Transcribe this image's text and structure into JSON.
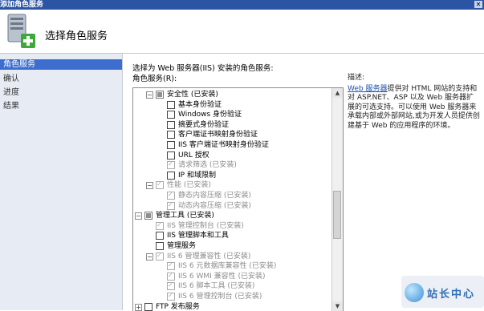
{
  "window": {
    "title": "添加角色服务",
    "close_glyph": "✕"
  },
  "header": {
    "title": "选择角色服务",
    "icon": "server-add-icon"
  },
  "nav": {
    "items": [
      {
        "label": "角色服务",
        "active": true
      },
      {
        "label": "确认",
        "active": false
      },
      {
        "label": "进度",
        "active": false
      },
      {
        "label": "结果",
        "active": false
      }
    ]
  },
  "main": {
    "prompt": "选择为 Web 服务器(IIS) 安装的角色服务:",
    "list_label": "角色服务(R):",
    "tree": [
      {
        "label": "安全性  (已安装)",
        "level": 1,
        "expander": "−",
        "state": "part",
        "disabled": false
      },
      {
        "label": "基本身份验证",
        "level": 2,
        "state": "off",
        "disabled": false
      },
      {
        "label": "Windows 身份验证",
        "level": 2,
        "state": "off",
        "disabled": false
      },
      {
        "label": "摘要式身份验证",
        "level": 2,
        "state": "off",
        "disabled": false
      },
      {
        "label": "客户端证书映射身份验证",
        "level": 2,
        "state": "off",
        "disabled": false
      },
      {
        "label": "IIS 客户端证书映射身份验证",
        "level": 2,
        "state": "off",
        "disabled": false
      },
      {
        "label": "URL 授权",
        "level": 2,
        "state": "off",
        "disabled": false
      },
      {
        "label": "请求筛选  (已安装)",
        "level": 2,
        "state": "chk",
        "disabled": true
      },
      {
        "label": "IP 和域限制",
        "level": 2,
        "state": "off",
        "disabled": false
      },
      {
        "label": "性能  (已安装)",
        "level": 1,
        "expander": "−",
        "state": "chk",
        "disabled": true
      },
      {
        "label": "静态内容压缩  (已安装)",
        "level": 2,
        "state": "chk",
        "disabled": true
      },
      {
        "label": "动态内容压缩  (已安装)",
        "level": 2,
        "state": "chk",
        "disabled": true
      },
      {
        "label": "管理工具  (已安装)",
        "level": 0,
        "expander": "−",
        "state": "part",
        "disabled": false
      },
      {
        "label": "IIS 管理控制台  (已安装)",
        "level": 1,
        "state": "chk",
        "disabled": true
      },
      {
        "label": "IIS 管理脚本和工具",
        "level": 1,
        "state": "off",
        "disabled": false
      },
      {
        "label": "管理服务",
        "level": 1,
        "state": "off",
        "disabled": false
      },
      {
        "label": "IIS 6 管理兼容性  (已安装)",
        "level": 1,
        "expander": "−",
        "state": "chk",
        "disabled": true
      },
      {
        "label": "IIS 6 元数据库兼容性  (已安装)",
        "level": 2,
        "state": "chk",
        "disabled": true
      },
      {
        "label": "IIS 6 WMI 兼容性  (已安装)",
        "level": 2,
        "state": "chk",
        "disabled": true
      },
      {
        "label": "IIS 6 脚本工具  (已安装)",
        "level": 2,
        "state": "chk",
        "disabled": true
      },
      {
        "label": "IIS 6 管理控制台  (已安装)",
        "level": 2,
        "state": "chk",
        "disabled": true
      },
      {
        "label": "FTP 发布服务",
        "level": 0,
        "expander": "+",
        "state": "off",
        "disabled": false
      }
    ]
  },
  "description": {
    "heading": "描述:",
    "link": "Web 服务器",
    "text": "提供对 HTML 网站的支持和对 ASP.NET、ASP 以及 Web 服务器扩展的可选支持。可以使用 Web 服务器来承载内部或外部网站,或为开发人员提供创建基于 Web 的应用程序的环境。"
  },
  "watermark": {
    "text": "站长中心"
  }
}
